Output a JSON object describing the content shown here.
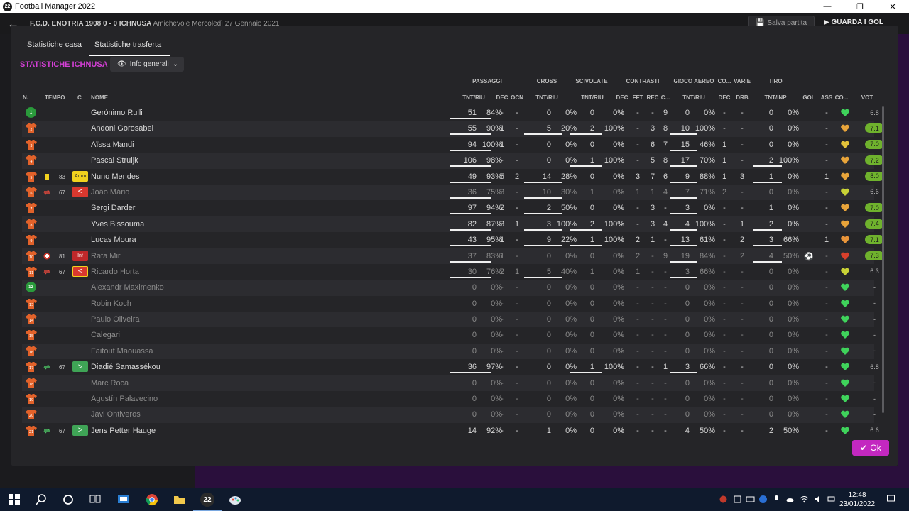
{
  "window": {
    "title": "Football Manager 2022",
    "logo_text": "22",
    "minimize": "—",
    "maximize": "❐",
    "close": "✕"
  },
  "appbar": {
    "match_team_a": "F.C.D. ENOTRIA 1908",
    "match_score": "0 - 0",
    "match_team_b": "ICHNUSA",
    "match_type": "Amichevole",
    "match_date": "Mercoledì 27 Gennaio 2021",
    "save_label": "Salva partita",
    "watch_label": "GUARDA I GOL"
  },
  "tabs": [
    {
      "label": "Statistiche casa"
    },
    {
      "label": "Statistiche trasferta"
    }
  ],
  "section_title": "STATISTICHE ICHNUSA",
  "dropdown": {
    "label": "Info generali"
  },
  "groups": {
    "passaggi": "PASSAGGI",
    "cross": "CROSS",
    "scivolate": "SCIVOLATE",
    "contrasti": "CONTRASTI",
    "gioco_aereo": "GIOCO AEREO",
    "co": "CO...",
    "varie": "VARIE",
    "tiro": "TIRO"
  },
  "columns": {
    "n": "N.",
    "tempo": "TEMPO",
    "c": "C",
    "nome": "NOME",
    "pass_tnt": "TNT/RIU",
    "pass_dec": "DEC",
    "pass_ocn": "OCN",
    "cross_tnt": "TNT/RIU",
    "sciv_tnt": "TNT/RIU",
    "contr_dec": "DEC",
    "contr_fft": "FFT",
    "contr_rec": "REC",
    "contr_c": "C...",
    "aereo_tnt": "TNT/RIU",
    "co_dec": "DEC",
    "varie_drb": "DRB",
    "tiro_tnt": "TNT/INP",
    "gol": "GOL",
    "ass": "ASS",
    "cond": "CO...",
    "vot": "VOT"
  },
  "players": [
    {
      "num": "1",
      "gk": true,
      "name": "Gerónimo Rulli",
      "pass_n": "51",
      "pass_p": "84%",
      "pass_bar": 1,
      "dec": "-",
      "ocn": "-",
      "cross_n": "0",
      "cross_p": "0%",
      "cross_bar": 0,
      "sciv_n": "0",
      "sciv_p": "0%",
      "sciv_bar": 0,
      "cdec": "-",
      "fft": "-",
      "rec": "-",
      "cc": "9",
      "aer_n": "0",
      "aer_p": "0%",
      "aer_bar": 0,
      "codec": "-",
      "drb": "-",
      "tiro_n": "0",
      "tiro_p": "0%",
      "tiro_bar": 0,
      "gol": "",
      "ass": "-",
      "heart": "#3fd35b",
      "vot": "6.8",
      "vot_good": false,
      "dim": false
    },
    {
      "num": "2",
      "name": "Andoni Gorosabel",
      "pass_n": "55",
      "pass_p": "90%",
      "pass_bar": 1,
      "dec": "1",
      "ocn": "-",
      "cross_n": "5",
      "cross_p": "20%",
      "cross_bar": 1,
      "sciv_n": "2",
      "sciv_p": "100%",
      "sciv_bar": 1,
      "cdec": "-",
      "fft": "-",
      "rec": "3",
      "cc": "8",
      "aer_n": "10",
      "aer_p": "100%",
      "aer_bar": 1,
      "codec": "-",
      "drb": "-",
      "tiro_n": "0",
      "tiro_p": "0%",
      "tiro_bar": 0,
      "gol": "",
      "ass": "-",
      "heart": "#e8a43a",
      "vot": "7.1",
      "vot_good": true,
      "dim": false
    },
    {
      "num": "3",
      "name": "Aïssa Mandi",
      "pass_n": "94",
      "pass_p": "100%",
      "pass_bar": 1,
      "dec": "1",
      "ocn": "-",
      "cross_n": "0",
      "cross_p": "0%",
      "cross_bar": 0,
      "sciv_n": "0",
      "sciv_p": "0%",
      "sciv_bar": 0,
      "cdec": "-",
      "fft": "-",
      "rec": "6",
      "cc": "7",
      "aer_n": "15",
      "aer_p": "46%",
      "aer_bar": 1,
      "codec": "1",
      "drb": "-",
      "tiro_n": "0",
      "tiro_p": "0%",
      "tiro_bar": 0,
      "gol": "",
      "ass": "-",
      "heart": "#e3c23a",
      "vot": "7.0",
      "vot_good": true,
      "dim": false
    },
    {
      "num": "4",
      "name": "Pascal Struijk",
      "pass_n": "106",
      "pass_p": "98%",
      "pass_bar": 1,
      "dec": "-",
      "ocn": "-",
      "cross_n": "0",
      "cross_p": "0%",
      "cross_bar": 0,
      "sciv_n": "1",
      "sciv_p": "100%",
      "sciv_bar": 1,
      "cdec": "-",
      "fft": "-",
      "rec": "5",
      "cc": "8",
      "aer_n": "17",
      "aer_p": "70%",
      "aer_bar": 1,
      "codec": "1",
      "drb": "-",
      "tiro_n": "2",
      "tiro_p": "100%",
      "tiro_bar": 1,
      "gol": "",
      "ass": "-",
      "heart": "#e8a43a",
      "vot": "7.2",
      "vot_good": true,
      "dim": false
    },
    {
      "num": "5",
      "yellow": true,
      "minute": "83",
      "badge": "amm",
      "badge_text": "Amm",
      "name": "Nuno Mendes",
      "pass_n": "49",
      "pass_p": "93%",
      "pass_bar": 1,
      "dec": "5",
      "ocn": "2",
      "cross_n": "14",
      "cross_p": "28%",
      "cross_bar": 1,
      "sciv_n": "0",
      "sciv_p": "0%",
      "sciv_bar": 0,
      "cdec": "-",
      "fft": "3",
      "rec": "7",
      "cc": "6",
      "aer_n": "9",
      "aer_p": "88%",
      "aer_bar": 1,
      "codec": "1",
      "drb": "3",
      "tiro_n": "1",
      "tiro_p": "0%",
      "tiro_bar": 1,
      "gol": "",
      "ass": "1",
      "heart": "#e8a43a",
      "vot": "8.0",
      "vot_good": true,
      "dim": false
    },
    {
      "num": "6",
      "sub_out": true,
      "minute": "67",
      "badge": "sub-out",
      "badge_text": "<",
      "name": "João Mário",
      "pass_n": "36",
      "pass_p": "75%",
      "pass_bar": 1,
      "dec": "3",
      "ocn": "-",
      "cross_n": "10",
      "cross_p": "30%",
      "cross_bar": 1,
      "sciv_n": "1",
      "sciv_p": "0%",
      "sciv_bar": 0,
      "cdec": "-",
      "fft": "1",
      "rec": "1",
      "cc": "4",
      "aer_n": "7",
      "aer_p": "71%",
      "aer_bar": 1,
      "codec": "2",
      "drb": "-",
      "tiro_n": "0",
      "tiro_p": "0%",
      "tiro_bar": 0,
      "gol": "",
      "ass": "-",
      "heart": "#c8d236",
      "vot": "6.6",
      "vot_good": false,
      "dim": true
    },
    {
      "num": "7",
      "name": "Sergi Darder",
      "pass_n": "97",
      "pass_p": "94%",
      "pass_bar": 1,
      "dec": "2",
      "ocn": "-",
      "cross_n": "2",
      "cross_p": "50%",
      "cross_bar": 1,
      "sciv_n": "0",
      "sciv_p": "0%",
      "sciv_bar": 0,
      "cdec": "-",
      "fft": "-",
      "rec": "3",
      "cc": "-",
      "aer_n": "3",
      "aer_p": "0%",
      "aer_bar": 1,
      "codec": "-",
      "drb": "-",
      "tiro_n": "1",
      "tiro_p": "0%",
      "tiro_bar": 0,
      "gol": "",
      "ass": "-",
      "heart": "#e8a43a",
      "vot": "7.0",
      "vot_good": true,
      "dim": false
    },
    {
      "num": "8",
      "name": "Yves Bissouma",
      "pass_n": "82",
      "pass_p": "87%",
      "pass_bar": 1,
      "dec": "3",
      "ocn": "1",
      "cross_n": "3",
      "cross_p": "100%",
      "cross_bar": 1,
      "sciv_n": "2",
      "sciv_p": "100%",
      "sciv_bar": 1,
      "cdec": "-",
      "fft": "-",
      "rec": "3",
      "cc": "4",
      "aer_n": "4",
      "aer_p": "100%",
      "aer_bar": 1,
      "codec": "-",
      "drb": "1",
      "tiro_n": "2",
      "tiro_p": "0%",
      "tiro_bar": 1,
      "gol": "",
      "ass": "-",
      "heart": "#e8a43a",
      "vot": "7.4",
      "vot_good": true,
      "dim": false
    },
    {
      "num": "9",
      "name": "Lucas Moura",
      "pass_n": "43",
      "pass_p": "95%",
      "pass_bar": 1,
      "dec": "1",
      "ocn": "-",
      "cross_n": "9",
      "cross_p": "22%",
      "cross_bar": 1,
      "sciv_n": "1",
      "sciv_p": "100%",
      "sciv_bar": 1,
      "cdec": "-",
      "fft": "2",
      "rec": "1",
      "cc": "-",
      "aer_n": "13",
      "aer_p": "61%",
      "aer_bar": 1,
      "codec": "-",
      "drb": "2",
      "tiro_n": "3",
      "tiro_p": "66%",
      "tiro_bar": 1,
      "gol": "",
      "ass": "1",
      "heart": "#e8943a",
      "vot": "7.1",
      "vot_good": true,
      "dim": false
    },
    {
      "num": "10",
      "injury": true,
      "minute": "81",
      "badge": "inf",
      "badge_text": "Inf",
      "name": "Rafa Mir",
      "pass_n": "37",
      "pass_p": "83%",
      "pass_bar": 1,
      "dec": "1",
      "ocn": "-",
      "cross_n": "0",
      "cross_p": "0%",
      "cross_bar": 0,
      "sciv_n": "0",
      "sciv_p": "0%",
      "sciv_bar": 0,
      "cdec": "-",
      "fft": "2",
      "rec": "-",
      "cc": "9",
      "aer_n": "19",
      "aer_p": "84%",
      "aer_bar": 1,
      "codec": "-",
      "drb": "2",
      "tiro_n": "4",
      "tiro_p": "50%",
      "tiro_bar": 1,
      "gol": "⚽",
      "ass": "-",
      "heart": "#d8402c",
      "vot": "7.3",
      "vot_good": true,
      "dim": true
    },
    {
      "num": "11",
      "sub_out": true,
      "minute": "67",
      "badge": "sub-out border",
      "badge_text": "<",
      "name": "Ricardo Horta",
      "pass_n": "30",
      "pass_p": "76%",
      "pass_bar": 1,
      "dec": "2",
      "ocn": "1",
      "cross_n": "5",
      "cross_p": "40%",
      "cross_bar": 1,
      "sciv_n": "1",
      "sciv_p": "0%",
      "sciv_bar": 0,
      "cdec": "-",
      "fft": "1",
      "rec": "-",
      "cc": "-",
      "aer_n": "3",
      "aer_p": "66%",
      "aer_bar": 1,
      "codec": "-",
      "drb": "-",
      "tiro_n": "0",
      "tiro_p": "0%",
      "tiro_bar": 0,
      "gol": "",
      "ass": "-",
      "heart": "#c8d236",
      "vot": "6.3",
      "vot_good": false,
      "dim": true
    },
    {
      "num": "12",
      "gk": true,
      "name": "Alexandr Maximenko",
      "pass_n": "0",
      "pass_p": "0%",
      "pass_bar": 0,
      "dec": "-",
      "ocn": "-",
      "cross_n": "0",
      "cross_p": "0%",
      "cross_bar": 0,
      "sciv_n": "0",
      "sciv_p": "0%",
      "sciv_bar": 0,
      "cdec": "-",
      "fft": "-",
      "rec": "-",
      "cc": "-",
      "aer_n": "0",
      "aer_p": "0%",
      "aer_bar": 0,
      "codec": "-",
      "drb": "-",
      "tiro_n": "0",
      "tiro_p": "0%",
      "tiro_bar": 0,
      "gol": "",
      "ass": "-",
      "heart": "#3fd35b",
      "vot": "-",
      "vot_good": false,
      "dim": true
    },
    {
      "num": "13",
      "name": "Robin Koch",
      "pass_n": "0",
      "pass_p": "0%",
      "pass_bar": 0,
      "dec": "-",
      "ocn": "-",
      "cross_n": "0",
      "cross_p": "0%",
      "cross_bar": 0,
      "sciv_n": "0",
      "sciv_p": "0%",
      "sciv_bar": 0,
      "cdec": "-",
      "fft": "-",
      "rec": "-",
      "cc": "-",
      "aer_n": "0",
      "aer_p": "0%",
      "aer_bar": 0,
      "codec": "-",
      "drb": "-",
      "tiro_n": "0",
      "tiro_p": "0%",
      "tiro_bar": 0,
      "gol": "",
      "ass": "-",
      "heart": "#3fd35b",
      "vot": "-",
      "vot_good": false,
      "dim": true
    },
    {
      "num": "14",
      "name": "Paulo Oliveira",
      "pass_n": "0",
      "pass_p": "0%",
      "pass_bar": 0,
      "dec": "-",
      "ocn": "-",
      "cross_n": "0",
      "cross_p": "0%",
      "cross_bar": 0,
      "sciv_n": "0",
      "sciv_p": "0%",
      "sciv_bar": 0,
      "cdec": "-",
      "fft": "-",
      "rec": "-",
      "cc": "-",
      "aer_n": "0",
      "aer_p": "0%",
      "aer_bar": 0,
      "codec": "-",
      "drb": "-",
      "tiro_n": "0",
      "tiro_p": "0%",
      "tiro_bar": 0,
      "gol": "",
      "ass": "-",
      "heart": "#3fd35b",
      "vot": "-",
      "vot_good": false,
      "dim": true
    },
    {
      "num": "15",
      "name": "Calegari",
      "pass_n": "0",
      "pass_p": "0%",
      "pass_bar": 0,
      "dec": "-",
      "ocn": "-",
      "cross_n": "0",
      "cross_p": "0%",
      "cross_bar": 0,
      "sciv_n": "0",
      "sciv_p": "0%",
      "sciv_bar": 0,
      "cdec": "-",
      "fft": "-",
      "rec": "-",
      "cc": "-",
      "aer_n": "0",
      "aer_p": "0%",
      "aer_bar": 0,
      "codec": "-",
      "drb": "-",
      "tiro_n": "0",
      "tiro_p": "0%",
      "tiro_bar": 0,
      "gol": "",
      "ass": "-",
      "heart": "#3fd35b",
      "vot": "-",
      "vot_good": false,
      "dim": true
    },
    {
      "num": "16",
      "name": "Faitout Maouassa",
      "pass_n": "0",
      "pass_p": "0%",
      "pass_bar": 0,
      "dec": "-",
      "ocn": "-",
      "cross_n": "0",
      "cross_p": "0%",
      "cross_bar": 0,
      "sciv_n": "0",
      "sciv_p": "0%",
      "sciv_bar": 0,
      "cdec": "-",
      "fft": "-",
      "rec": "-",
      "cc": "-",
      "aer_n": "0",
      "aer_p": "0%",
      "aer_bar": 0,
      "codec": "-",
      "drb": "-",
      "tiro_n": "0",
      "tiro_p": "0%",
      "tiro_bar": 0,
      "gol": "",
      "ass": "-",
      "heart": "#3fd35b",
      "vot": "-",
      "vot_good": false,
      "dim": true
    },
    {
      "num": "17",
      "sub_in": true,
      "minute": "67",
      "badge": "sub-in",
      "badge_text": ">",
      "name": "Diadié Samassékou",
      "pass_n": "36",
      "pass_p": "97%",
      "pass_bar": 1,
      "dec": "-",
      "ocn": "-",
      "cross_n": "0",
      "cross_p": "0%",
      "cross_bar": 0,
      "sciv_n": "1",
      "sciv_p": "100%",
      "sciv_bar": 1,
      "cdec": "-",
      "fft": "-",
      "rec": "-",
      "cc": "1",
      "aer_n": "3",
      "aer_p": "66%",
      "aer_bar": 1,
      "codec": "-",
      "drb": "-",
      "tiro_n": "0",
      "tiro_p": "0%",
      "tiro_bar": 0,
      "gol": "",
      "ass": "-",
      "heart": "#3fd35b",
      "vot": "6.8",
      "vot_good": false,
      "dim": false
    },
    {
      "num": "18",
      "name": "Marc Roca",
      "pass_n": "0",
      "pass_p": "0%",
      "pass_bar": 0,
      "dec": "-",
      "ocn": "-",
      "cross_n": "0",
      "cross_p": "0%",
      "cross_bar": 0,
      "sciv_n": "0",
      "sciv_p": "0%",
      "sciv_bar": 0,
      "cdec": "-",
      "fft": "-",
      "rec": "-",
      "cc": "-",
      "aer_n": "0",
      "aer_p": "0%",
      "aer_bar": 0,
      "codec": "-",
      "drb": "-",
      "tiro_n": "0",
      "tiro_p": "0%",
      "tiro_bar": 0,
      "gol": "",
      "ass": "-",
      "heart": "#3fd35b",
      "vot": "-",
      "vot_good": false,
      "dim": true
    },
    {
      "num": "19",
      "name": "Agustín Palavecino",
      "pass_n": "0",
      "pass_p": "0%",
      "pass_bar": 0,
      "dec": "-",
      "ocn": "-",
      "cross_n": "0",
      "cross_p": "0%",
      "cross_bar": 0,
      "sciv_n": "0",
      "sciv_p": "0%",
      "sciv_bar": 0,
      "cdec": "-",
      "fft": "-",
      "rec": "-",
      "cc": "-",
      "aer_n": "0",
      "aer_p": "0%",
      "aer_bar": 0,
      "codec": "-",
      "drb": "-",
      "tiro_n": "0",
      "tiro_p": "0%",
      "tiro_bar": 0,
      "gol": "",
      "ass": "-",
      "heart": "#3fd35b",
      "vot": "-",
      "vot_good": false,
      "dim": true
    },
    {
      "num": "20",
      "name": "Javi Ontiveros",
      "pass_n": "0",
      "pass_p": "0%",
      "pass_bar": 0,
      "dec": "-",
      "ocn": "-",
      "cross_n": "0",
      "cross_p": "0%",
      "cross_bar": 0,
      "sciv_n": "0",
      "sciv_p": "0%",
      "sciv_bar": 0,
      "cdec": "-",
      "fft": "-",
      "rec": "-",
      "cc": "-",
      "aer_n": "0",
      "aer_p": "0%",
      "aer_bar": 0,
      "codec": "-",
      "drb": "-",
      "tiro_n": "0",
      "tiro_p": "0%",
      "tiro_bar": 0,
      "gol": "",
      "ass": "-",
      "heart": "#3fd35b",
      "vot": "-",
      "vot_good": false,
      "dim": true
    },
    {
      "num": "21",
      "sub_in": true,
      "minute": "67",
      "badge": "sub-in",
      "badge_text": ">",
      "name": "Jens Petter Hauge",
      "pass_n": "14",
      "pass_p": "92%",
      "pass_bar": 0,
      "dec": "-",
      "ocn": "-",
      "cross_n": "1",
      "cross_p": "0%",
      "cross_bar": 0,
      "sciv_n": "0",
      "sciv_p": "0%",
      "sciv_bar": 0,
      "cdec": "-",
      "fft": "-",
      "rec": "-",
      "cc": "-",
      "aer_n": "4",
      "aer_p": "50%",
      "aer_bar": 0,
      "codec": "-",
      "drb": "-",
      "tiro_n": "2",
      "tiro_p": "50%",
      "tiro_bar": 0,
      "gol": "",
      "ass": "-",
      "heart": "#3fd35b",
      "vot": "6.6",
      "vot_good": false,
      "dim": false
    }
  ],
  "ok_button": {
    "label": "Ok"
  },
  "taskbar": {
    "time": "12:48",
    "date": "23/01/2022",
    "fm_label": "22"
  }
}
